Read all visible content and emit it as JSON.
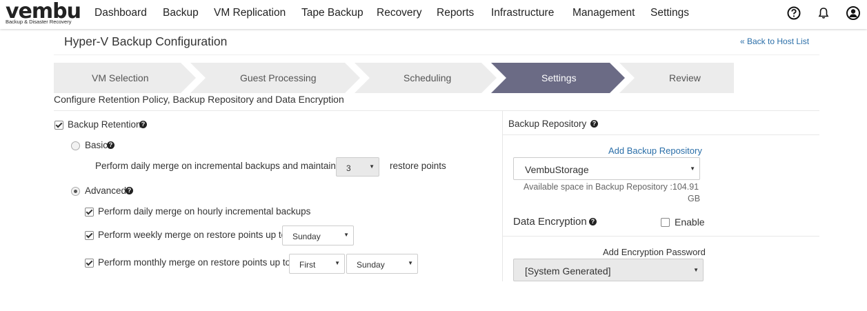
{
  "brand": {
    "name": "vembu",
    "tagline": "Backup & Disaster Recovery"
  },
  "nav": {
    "items": [
      "Dashboard",
      "Backup",
      "VM Replication",
      "Tape Backup",
      "Recovery",
      "Reports",
      "Infrastructure",
      "Management",
      "Settings"
    ],
    "icons": [
      "help-circle-icon",
      "bell-icon",
      "user-icon"
    ]
  },
  "page": {
    "title": "Hyper-V Backup Configuration",
    "back_link": "« Back to Host List"
  },
  "wizard": {
    "steps": [
      "VM Selection",
      "Guest Processing",
      "Scheduling",
      "Settings",
      "Review"
    ],
    "active_index": 3,
    "colors": {
      "inactive": "#ececec",
      "active": "#6b6b85"
    }
  },
  "subtitle": "Configure Retention Policy, Backup Repository and Data Encryption",
  "retention": {
    "label": "Backup Retention",
    "checked": true,
    "basic": {
      "label": "Basic",
      "selected": false,
      "text_before": "Perform daily merge on incremental backups and maintain",
      "value": "3",
      "text_after": "restore points"
    },
    "advanced": {
      "label": "Advanced",
      "selected": true,
      "daily_label": "Perform daily merge on hourly incremental backups",
      "weekly_label": "Perform weekly merge on restore points up to",
      "weekly_day": "Sunday",
      "monthly_label": "Perform monthly merge on restore points up to",
      "monthly_week": "First",
      "monthly_day": "Sunday"
    }
  },
  "repository": {
    "label": "Backup Repository",
    "add_link": "Add Backup Repository",
    "selected": "VembuStorage",
    "space_line1": "Available space in Backup Repository :104.91",
    "space_line2": "GB"
  },
  "encryption": {
    "label": "Data Encryption",
    "enable_label": "Enable",
    "enabled": false,
    "password_label": "Add Encryption Password",
    "password_value": "[System Generated]"
  }
}
